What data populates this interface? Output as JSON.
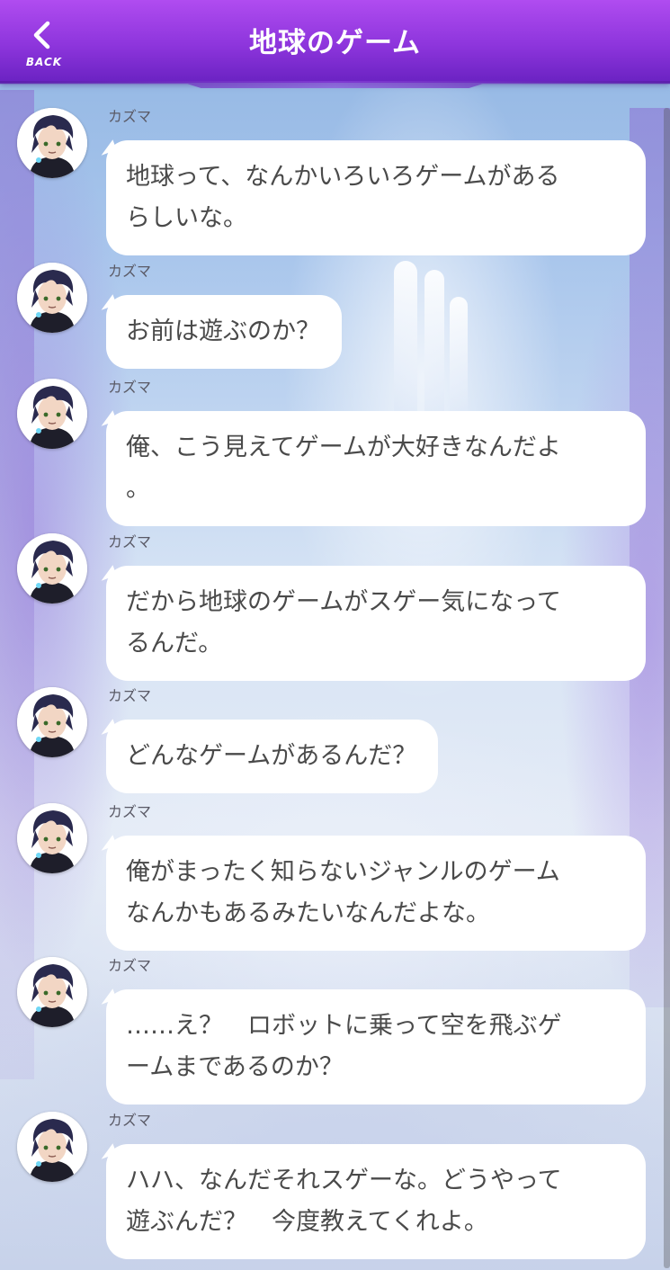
{
  "header": {
    "back_label": "BACK",
    "title": "地球のゲーム"
  },
  "icons": {
    "back": "chevron-left-icon",
    "avatar": "character-portrait"
  },
  "colors": {
    "header_top": "#b04cf0",
    "header_bottom": "#6a22c2",
    "bubble": "#ffffff",
    "text": "#4a4a4a"
  },
  "messages": [
    {
      "speaker": "カズマ",
      "line1": "地球って、なんかいろいろゲームがある",
      "line2": "らしいな。"
    },
    {
      "speaker": "カズマ",
      "line1": "お前は遊ぶのか？",
      "line2": ""
    },
    {
      "speaker": "カズマ",
      "line1": "俺、こう見えてゲームが大好きなんだよ",
      "line2": "。"
    },
    {
      "speaker": "カズマ",
      "line1": "だから地球のゲームがスゲー気になって",
      "line2": "るんだ。"
    },
    {
      "speaker": "カズマ",
      "line1": "どんなゲームがあるんだ？",
      "line2": ""
    },
    {
      "speaker": "カズマ",
      "line1": "俺がまったく知らないジャンルのゲーム",
      "line2": "なんかもあるみたいなんだよな。"
    },
    {
      "speaker": "カズマ",
      "line1": "……え？　ロボットに乗って空を飛ぶゲ",
      "line2": "ームまであるのか？"
    },
    {
      "speaker": "カズマ",
      "line1": "ハハ、なんだそれスゲーな。どうやって",
      "line2": "遊ぶんだ？　今度教えてくれよ。"
    }
  ]
}
